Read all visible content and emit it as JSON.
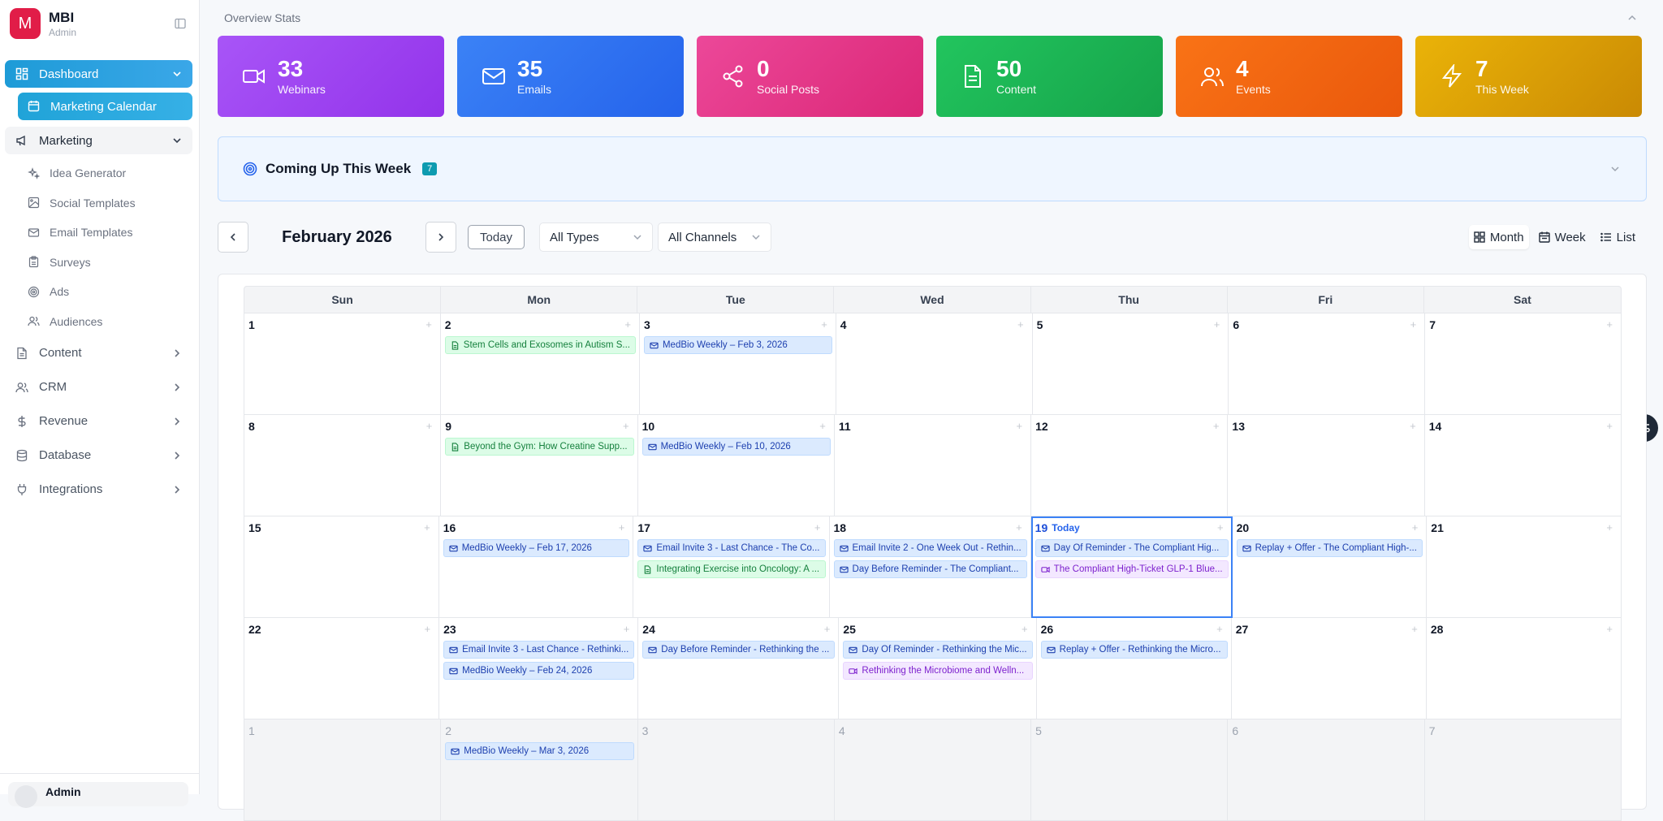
{
  "brand": {
    "initial": "M",
    "name": "MBI",
    "role": "Admin"
  },
  "nav": {
    "dashboard": "Dashboard",
    "marketing_calendar": "Marketing Calendar",
    "marketing": "Marketing",
    "marketing_sub": [
      "Idea Generator",
      "Social Templates",
      "Email Templates",
      "Surveys",
      "Ads",
      "Audiences"
    ],
    "content": "Content",
    "crm": "CRM",
    "revenue": "Revenue",
    "database": "Database",
    "integrations": "Integrations"
  },
  "footer": {
    "user": "Admin"
  },
  "overview": {
    "title": "Overview Stats"
  },
  "stats": [
    {
      "value": "33",
      "label": "Webinars",
      "icon": "video-icon"
    },
    {
      "value": "35",
      "label": "Emails",
      "icon": "mail-icon"
    },
    {
      "value": "0",
      "label": "Social Posts",
      "icon": "share-icon"
    },
    {
      "value": "50",
      "label": "Content",
      "icon": "document-icon"
    },
    {
      "value": "4",
      "label": "Events",
      "icon": "users-icon"
    },
    {
      "value": "7",
      "label": "This Week",
      "icon": "lightning-icon"
    }
  ],
  "coming_up": {
    "title": "Coming Up This Week",
    "count": "7"
  },
  "toolbar": {
    "month": "February 2026",
    "today": "Today",
    "types": "All Types",
    "channels": "All Channels",
    "views": [
      "Month",
      "Week",
      "List"
    ]
  },
  "calendar": {
    "weekdays": [
      "Sun",
      "Mon",
      "Tue",
      "Wed",
      "Thu",
      "Fri",
      "Sat"
    ],
    "today_label": "Today",
    "weeks": [
      [
        {
          "d": "1"
        },
        {
          "d": "2",
          "events": [
            {
              "type": "content",
              "text": "Stem Cells and Exosomes in Autism S..."
            }
          ]
        },
        {
          "d": "3",
          "events": [
            {
              "type": "email",
              "text": "MedBio Weekly – Feb 3, 2026"
            }
          ]
        },
        {
          "d": "4"
        },
        {
          "d": "5"
        },
        {
          "d": "6"
        },
        {
          "d": "7"
        }
      ],
      [
        {
          "d": "8"
        },
        {
          "d": "9",
          "events": [
            {
              "type": "content",
              "text": "Beyond the Gym: How Creatine Supp..."
            }
          ]
        },
        {
          "d": "10",
          "events": [
            {
              "type": "email",
              "text": "MedBio Weekly – Feb 10, 2026"
            }
          ]
        },
        {
          "d": "11"
        },
        {
          "d": "12"
        },
        {
          "d": "13"
        },
        {
          "d": "14"
        }
      ],
      [
        {
          "d": "15"
        },
        {
          "d": "16",
          "events": [
            {
              "type": "email",
              "text": "MedBio Weekly – Feb 17, 2026"
            }
          ]
        },
        {
          "d": "17",
          "events": [
            {
              "type": "email",
              "text": "Email Invite 3 - Last Chance - The Co..."
            },
            {
              "type": "content",
              "text": "Integrating Exercise into Oncology: A ..."
            }
          ]
        },
        {
          "d": "18",
          "events": [
            {
              "type": "email",
              "text": "Email Invite 2 - One Week Out - Rethin..."
            },
            {
              "type": "email",
              "text": "Day Before Reminder - The Compliant..."
            }
          ]
        },
        {
          "d": "19",
          "today": true,
          "events": [
            {
              "type": "email",
              "text": "Day Of Reminder - The Compliant Hig..."
            },
            {
              "type": "webinar",
              "text": "The Compliant High-Ticket GLP-1 Blue..."
            }
          ]
        },
        {
          "d": "20",
          "events": [
            {
              "type": "email",
              "text": "Replay + Offer - The Compliant High-..."
            }
          ]
        },
        {
          "d": "21"
        }
      ],
      [
        {
          "d": "22"
        },
        {
          "d": "23",
          "events": [
            {
              "type": "email",
              "text": "Email Invite 3 - Last Chance - Rethinki..."
            },
            {
              "type": "email",
              "text": "MedBio Weekly – Feb 24, 2026"
            }
          ]
        },
        {
          "d": "24",
          "events": [
            {
              "type": "email",
              "text": "Day Before Reminder - Rethinking the ..."
            }
          ]
        },
        {
          "d": "25",
          "events": [
            {
              "type": "email",
              "text": "Day Of Reminder - Rethinking the Mic..."
            },
            {
              "type": "webinar",
              "text": "Rethinking the Microbiome and Welln..."
            }
          ]
        },
        {
          "d": "26",
          "events": [
            {
              "type": "email",
              "text": "Replay + Offer - Rethinking the Micro..."
            }
          ]
        },
        {
          "d": "27"
        },
        {
          "d": "28"
        }
      ],
      [
        {
          "d": "1",
          "other": true
        },
        {
          "d": "2",
          "other": true,
          "events": [
            {
              "type": "email",
              "text": "MedBio Weekly – Mar 3, 2026"
            }
          ]
        },
        {
          "d": "3",
          "other": true
        },
        {
          "d": "4",
          "other": true
        },
        {
          "d": "5",
          "other": true
        },
        {
          "d": "6",
          "other": true
        },
        {
          "d": "7",
          "other": true
        }
      ]
    ]
  }
}
